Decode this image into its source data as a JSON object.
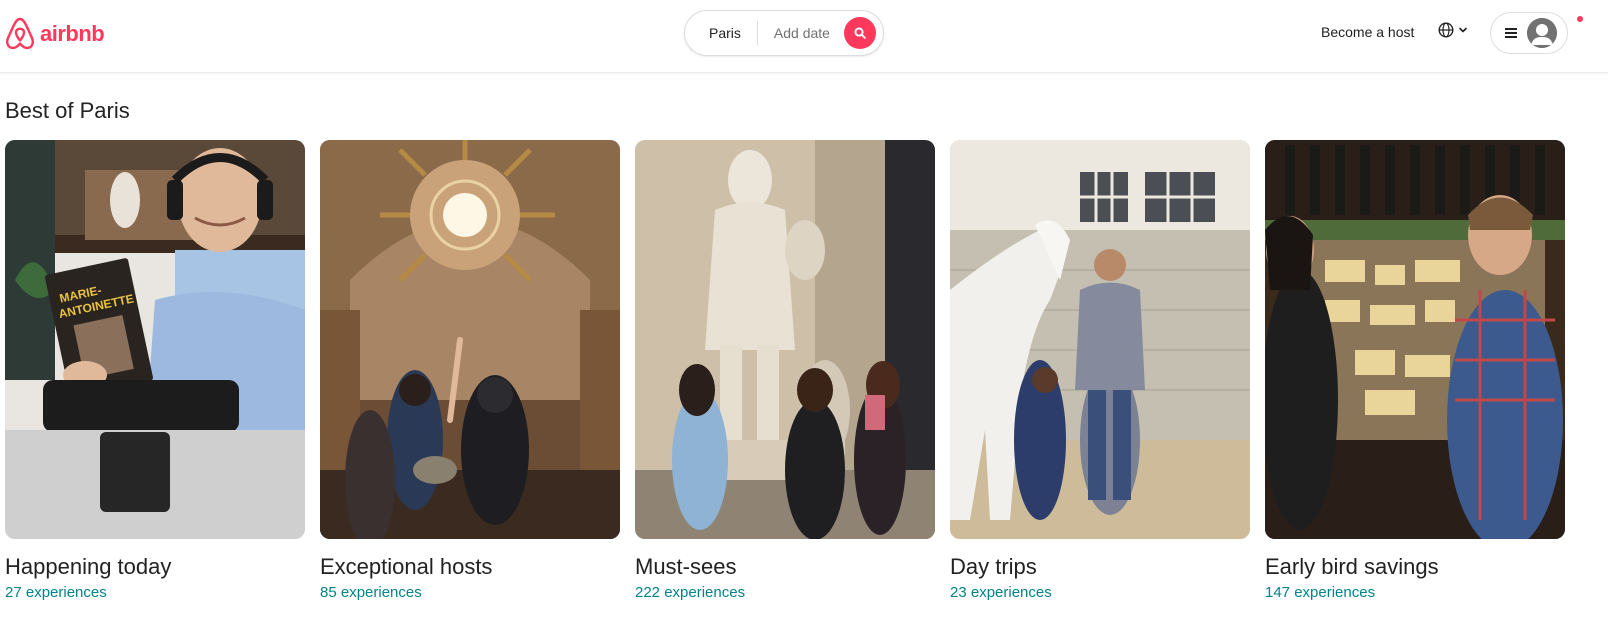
{
  "header": {
    "logo_text": "airbnb",
    "search": {
      "location": "Paris",
      "date_placeholder": "Add date"
    },
    "become_host": "Become a host"
  },
  "section": {
    "title": "Best of Paris",
    "cards": [
      {
        "title": "Happening today",
        "count": "27 experiences",
        "image": "online-host-with-book-photo"
      },
      {
        "title": "Exceptional hosts",
        "count": "85 experiences",
        "image": "palace-interior-tour-photo"
      },
      {
        "title": "Must-sees",
        "count": "222 experiences",
        "image": "louvre-statue-visitors-photo"
      },
      {
        "title": "Day trips",
        "count": "23 experiences",
        "image": "horse-stable-photo"
      },
      {
        "title": "Early bird savings",
        "count": "147 experiences",
        "image": "cheese-shop-hosts-photo"
      }
    ]
  },
  "colors": {
    "brand": "#FF385C",
    "count_link": "#008489",
    "text": "#222222",
    "muted": "#717171"
  },
  "icons": [
    "airbnb-logo-icon",
    "search-icon",
    "globe-icon",
    "chevron-down-icon",
    "menu-icon",
    "user-avatar-icon",
    "notification-dot-icon"
  ]
}
